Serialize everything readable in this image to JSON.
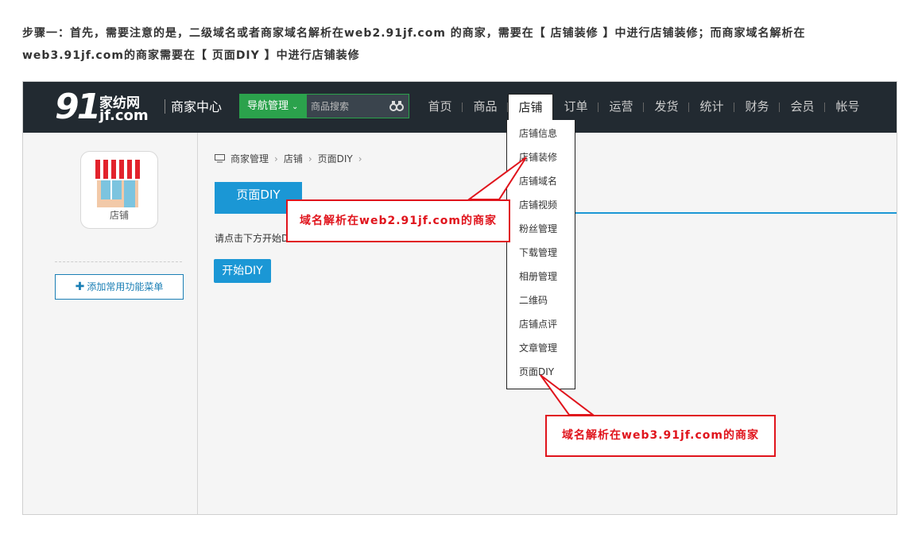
{
  "intro": {
    "line1": "步骤一：首先，需要注意的是，二级域名或者商家域名解析在web2.91jf.com 的商家，需要在【 店铺装修 】中进行店铺装修；而商家域名解析在",
    "line2": "web3.91jf.com的商家需要在【 页面DIY 】中进行店铺装修"
  },
  "header": {
    "logo_number": "91",
    "logo_cn": "家纺网",
    "logo_en": "jf.com",
    "merchant_center": "商家中心",
    "nav_manage": "导航管理",
    "search_placeholder": "商品搜索"
  },
  "menu": [
    "首页",
    "商品",
    "店铺",
    "订单",
    "运营",
    "发货",
    "统计",
    "财务",
    "会员",
    "帐号"
  ],
  "dropdown": [
    "店铺信息",
    "店铺装修",
    "店铺域名",
    "店铺视频",
    "粉丝管理",
    "下载管理",
    "相册管理",
    "二维码",
    "店铺点评",
    "文章管理",
    "页面DIY"
  ],
  "sidebar": {
    "shop_label": "店铺",
    "add_menu": "添加常用功能菜单"
  },
  "breadcrumb": [
    "商家管理",
    "店铺",
    "页面DIY"
  ],
  "main": {
    "tab": "页面DIY",
    "hint": "请点击下方开始D",
    "start_button": "开始DIY"
  },
  "callouts": {
    "web2": "域名解析在web2.91jf.com的商家",
    "web3": "域名解析在web3.91jf.com的商家"
  },
  "colors": {
    "topbar": "#222a31",
    "accent_blue": "#1b97d5",
    "nav_green": "#2ba24c",
    "callout_red": "#e0141c"
  }
}
